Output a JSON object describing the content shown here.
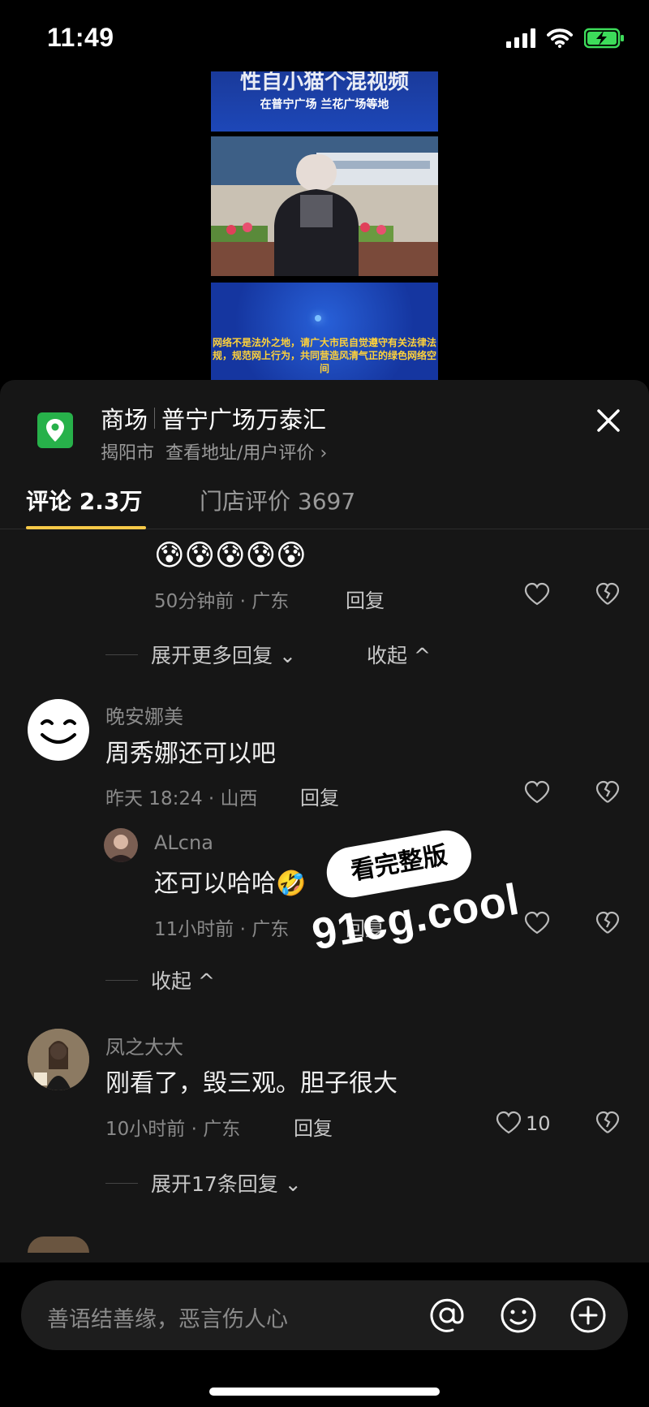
{
  "status_bar": {
    "time": "11:49"
  },
  "video": {
    "banner_top_text": "在普宁广场 兰花广场等地",
    "banner_top_partial": "性自小猫个混视频",
    "caption": "网络不是法外之地，请广大市民自觉遵守有关法律法规，规范网上行为，共同营造风清气正的绿色网络空间"
  },
  "poi": {
    "category": "商场",
    "name": "普宁广场万泰汇",
    "city": "揭阳市",
    "link": "查看地址/用户评价",
    "link_chevron": "›"
  },
  "tabs": [
    {
      "label": "评论 2.3万"
    },
    {
      "label": "门店评价 3697"
    }
  ],
  "comments": [
    {
      "emojis": "😰😰😰😰😰",
      "meta": "50分钟前 · 广东",
      "reply": "回复",
      "expand": "展开更多回复 ⌄",
      "collapse": "收起 ^"
    },
    {
      "user": "晚安娜美",
      "text": "周秀娜还可以吧",
      "meta": "昨天 18:24 · 山西",
      "reply": "回复",
      "sub_reply": {
        "user": "ALcna",
        "text": "还可以哈哈🤣",
        "meta": "11小时前 · 广东",
        "reply": "回复"
      },
      "collapse": "收起 ^"
    },
    {
      "user": "凤之大大",
      "text": "刚看了，毁三观。胆子很大",
      "meta": "10小时前 · 广东",
      "reply": "回复",
      "likes": "10",
      "expand": "展开17条回复 ⌄"
    }
  ],
  "input": {
    "placeholder": "善语结善缘，恶言伤人心"
  },
  "watermark": {
    "bubble": "看完整版",
    "url": "91cg.cool"
  },
  "colors": {
    "accent_underline": "#f7c948",
    "poi_pin": "#27b14a",
    "battery": "#3ddc5a"
  }
}
